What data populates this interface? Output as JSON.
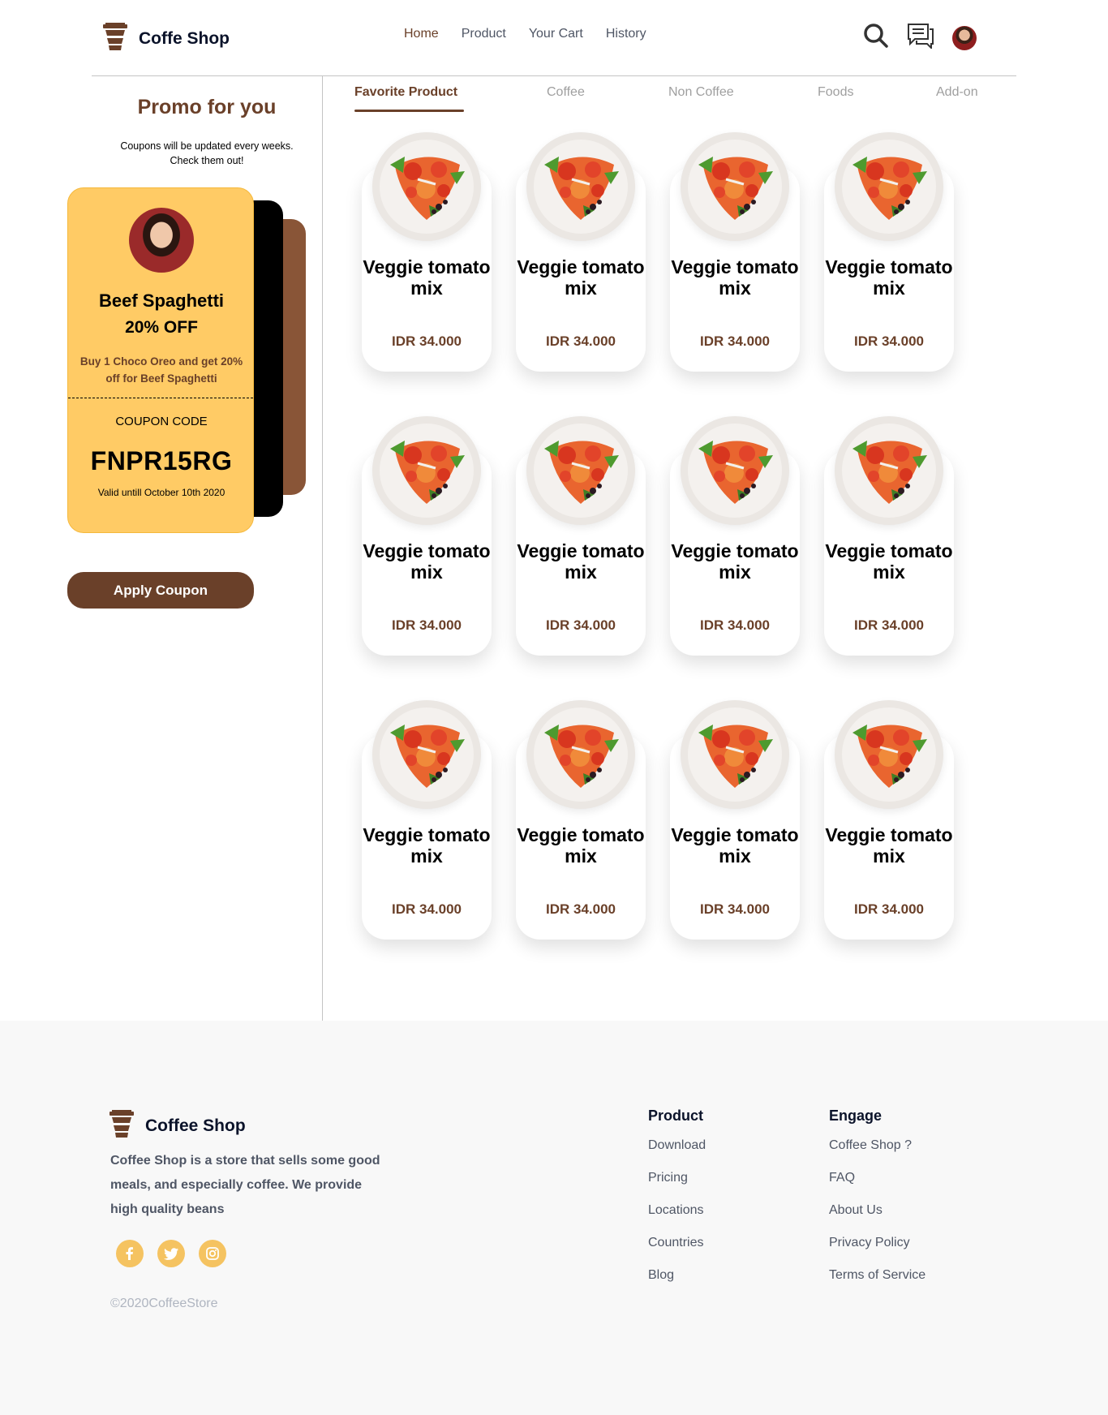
{
  "header": {
    "brand": "Coffe Shop",
    "nav": [
      "Home",
      "Product",
      "Your Cart",
      "History"
    ],
    "icons": [
      "search-icon",
      "chat-icon",
      "user-avatar"
    ]
  },
  "promo": {
    "title": "Promo for you",
    "subtitle": [
      "Coupons will be updated every weeks.",
      "Check them out!"
    ],
    "coupon": {
      "name": "Beef Spaghetti",
      "discount": "20% OFF",
      "description": "Buy 1 Choco Oreo and get 20% off for Beef Spaghetti",
      "code_label": "COUPON CODE",
      "code": "FNPR15RG",
      "valid": "Valid untill October 10th 2020"
    },
    "apply_label": "Apply Coupon"
  },
  "tabs": [
    "Favorite Product",
    "Coffee",
    "Non Coffee",
    "Foods",
    "Add-on"
  ],
  "products": [
    {
      "name": "Veggie tomato mix",
      "price": "IDR 34.000"
    },
    {
      "name": "Veggie tomato mix",
      "price": "IDR 34.000"
    },
    {
      "name": "Veggie tomato mix",
      "price": "IDR 34.000"
    },
    {
      "name": "Veggie tomato mix",
      "price": "IDR 34.000"
    },
    {
      "name": "Veggie tomato mix",
      "price": "IDR 34.000"
    },
    {
      "name": "Veggie tomato mix",
      "price": "IDR 34.000"
    },
    {
      "name": "Veggie tomato mix",
      "price": "IDR 34.000"
    },
    {
      "name": "Veggie tomato mix",
      "price": "IDR 34.000"
    },
    {
      "name": "Veggie tomato mix",
      "price": "IDR 34.000"
    },
    {
      "name": "Veggie tomato mix",
      "price": "IDR 34.000"
    },
    {
      "name": "Veggie tomato mix",
      "price": "IDR 34.000"
    },
    {
      "name": "Veggie tomato mix",
      "price": "IDR 34.000"
    }
  ],
  "footer": {
    "brand": "Coffee Shop",
    "description": [
      "Coffee Shop is a store that sells some good",
      "meals, and especially coffee. We provide",
      "high quality beans"
    ],
    "socials": [
      "facebook-icon",
      "twitter-icon",
      "instagram-icon"
    ],
    "copyright": "©2020CoffeeStore",
    "product_title": "Product",
    "product_links": [
      "Download",
      "Pricing",
      "Locations",
      "Countries",
      "Blog"
    ],
    "engage_title": "Engage",
    "engage_links": [
      "Coffee Shop ?",
      "FAQ",
      "About Us",
      "Privacy Policy",
      "Terms of Service"
    ]
  },
  "colors": {
    "brown": "#6a4029",
    "coupon_yellow": "#ffcb65",
    "social_yellow": "#f5c361",
    "footer_bg": "#f8f8f8"
  }
}
